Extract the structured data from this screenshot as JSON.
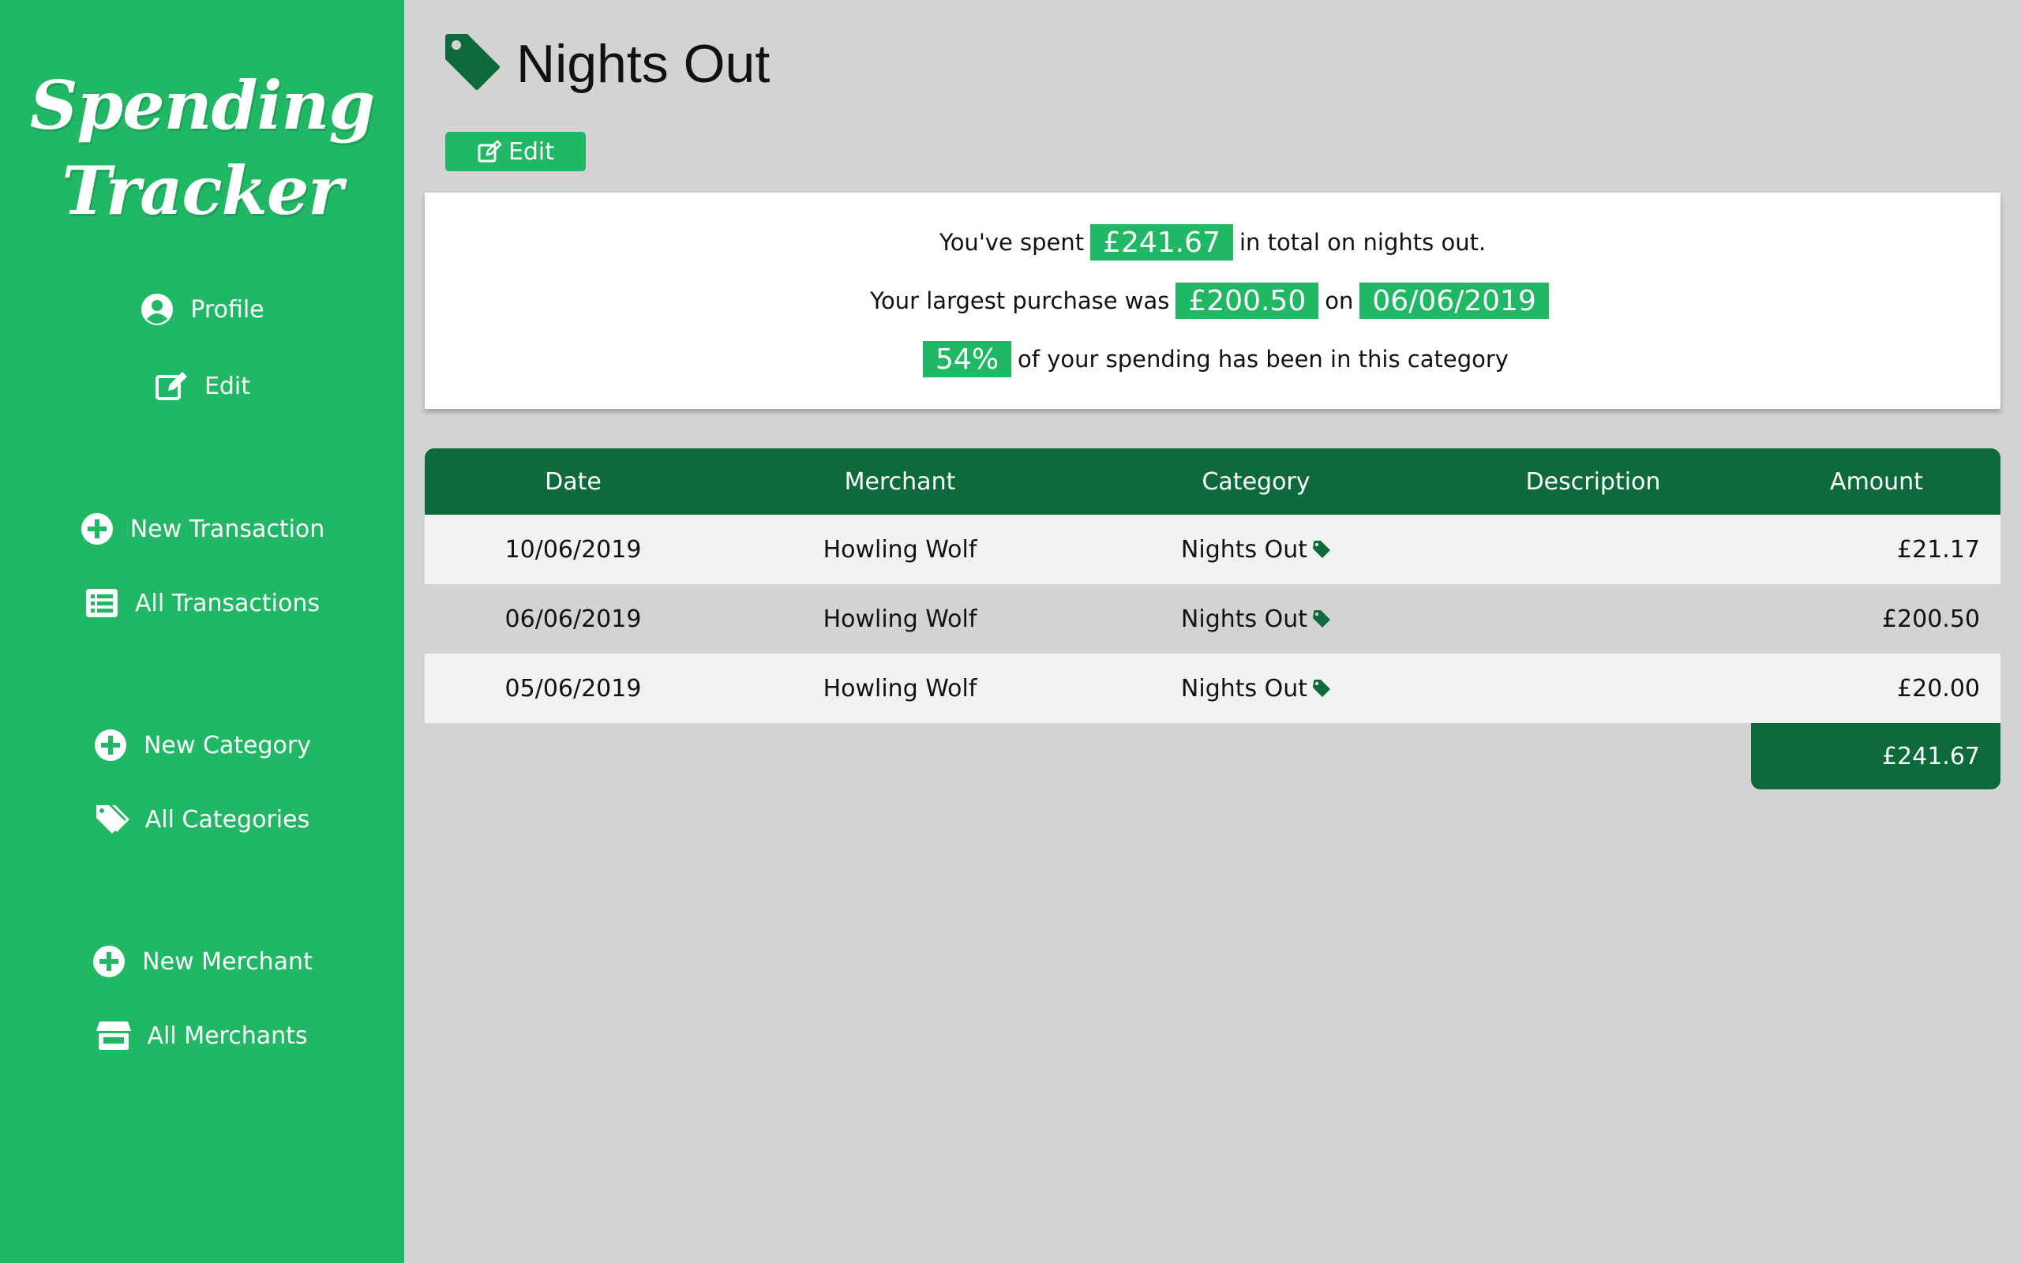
{
  "app": {
    "logo_line1": "Spending",
    "logo_line2": "Tracker",
    "accent_color": "#20b864",
    "dark_color": "#0f6a3b"
  },
  "sidebar": {
    "items": [
      {
        "label": "Profile",
        "icon": "user-circle-icon"
      },
      {
        "label": "Edit",
        "icon": "edit-icon"
      },
      {
        "label": "New Transaction",
        "icon": "plus-circle-icon"
      },
      {
        "label": "All Transactions",
        "icon": "list-icon"
      },
      {
        "label": "New Category",
        "icon": "plus-circle-icon"
      },
      {
        "label": "All Categories",
        "icon": "tags-icon"
      },
      {
        "label": "New Merchant",
        "icon": "plus-circle-icon"
      },
      {
        "label": "All Merchants",
        "icon": "store-icon"
      }
    ]
  },
  "page": {
    "title": "Nights Out",
    "title_icon": "tag-icon",
    "edit_label": "Edit"
  },
  "summary": {
    "line1_prefix": "You've spent",
    "total": "£241.67",
    "line1_suffix": "in total on nights out.",
    "line2_prefix": "Your largest purchase was",
    "largest": "£200.50",
    "line2_mid": "on",
    "largest_date": "06/06/2019",
    "percent": "54%",
    "line3_suffix": "of your spending has been in this category"
  },
  "table": {
    "headers": {
      "date": "Date",
      "merchant": "Merchant",
      "category": "Category",
      "description": "Description",
      "amount": "Amount"
    },
    "rows": [
      {
        "date": "10/06/2019",
        "merchant": "Howling Wolf",
        "category": "Nights Out",
        "description": "",
        "amount": "£21.17"
      },
      {
        "date": "06/06/2019",
        "merchant": "Howling Wolf",
        "category": "Nights Out",
        "description": "",
        "amount": "£200.50"
      },
      {
        "date": "05/06/2019",
        "merchant": "Howling Wolf",
        "category": "Nights Out",
        "description": "",
        "amount": "£20.00"
      }
    ],
    "total": "£241.67"
  }
}
